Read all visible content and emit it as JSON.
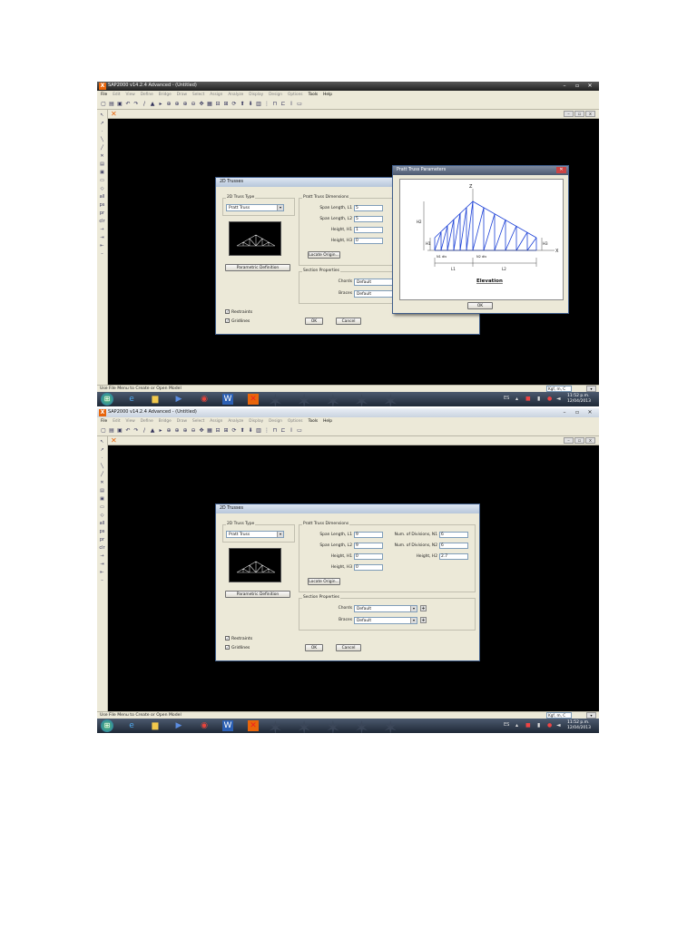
{
  "screenshot_1": {
    "window_title": "SAP2000 v14.2.4 Advanced - (Untitled)",
    "status_text": "Use File Menu to Create or Open Model",
    "units": "Kgf, m, C",
    "dialog": {
      "title": "2D Trusses",
      "truss_type_group": "2D Truss Type",
      "truss_type_value": "Pratt Truss",
      "dimensions_group": "Pratt Truss Dimensions",
      "span_l1_label": "Span Length, L1",
      "span_l1_value": "5",
      "span_l2_label": "Span Length, L2",
      "span_l2_value": "5",
      "height_h1_label": "Height, H1",
      "height_h1_value": "1",
      "height_h3_label": "Height, H3",
      "height_h3_value": "0",
      "locate_origin": "Locate Origin...",
      "parametric_button": "Parametric Definition",
      "section_group": "Section Properties",
      "chords_label": "Chords",
      "chords_value": "Default",
      "braces_label": "Braces",
      "braces_value": "Default",
      "restraints": "Restraints",
      "gridlines": "Gridlines",
      "ok": "OK",
      "cancel": "Cancel"
    },
    "popup": {
      "title": "Pratt Truss Parameters",
      "z_axis": "Z",
      "x_axis": "X",
      "h1": "H1",
      "h2": "H2",
      "h3": "H3",
      "n1_note": "N1 div",
      "n2_note": "N2 div",
      "l1": "L1",
      "l2": "L2",
      "caption": "Elevation",
      "ok": "OK"
    }
  },
  "screenshot_2": {
    "window_title": "SAP2000 v14.2.4 Advanced - (Untitled)",
    "status_text": "Use File Menu to Create or Open Model",
    "units": "Kgf, m, C",
    "dialog": {
      "title": "2D Trusses",
      "truss_type_group": "2D Truss Type",
      "truss_type_value": "Pratt Truss",
      "dimensions_group": "Pratt Truss Dimensions",
      "span_l1_label": "Span Length, L1",
      "span_l1_value": "9",
      "span_l2_label": "Span Length, L2",
      "span_l2_value": "9",
      "height_h1_label": "Height, H1",
      "height_h1_value": "0",
      "height_h3_label": "Height, H3",
      "height_h3_value": "0",
      "div_n1_label": "Num. of Divisions, N1",
      "div_n1_value": "6",
      "div_n2_label": "Num. of Divisions, N2",
      "div_n2_value": "6",
      "height_h2_label": "Height, H2",
      "height_h2_value": "2.7",
      "locate_origin": "Locate Origin...",
      "parametric_button": "Parametric Definition",
      "section_group": "Section Properties",
      "chords_label": "Chords",
      "chords_value": "Default",
      "braces_label": "Braces",
      "braces_value": "Default",
      "restraints": "Restraints",
      "gridlines": "Gridlines",
      "ok": "OK",
      "cancel": "Cancel"
    }
  },
  "menu": [
    "File",
    "Edit",
    "View",
    "Define",
    "Bridge",
    "Draw",
    "Select",
    "Assign",
    "Analyze",
    "Display",
    "Design",
    "Options",
    "Tools",
    "Help"
  ],
  "taskbar": {
    "language": "ES",
    "clock_time": "11:52 p.m.",
    "clock_date": "12/04/2013"
  },
  "colors": {
    "truss_lines": "#1a3fd6",
    "app_orange": "#e8650b",
    "dialog_bg": "#ece9d8"
  }
}
